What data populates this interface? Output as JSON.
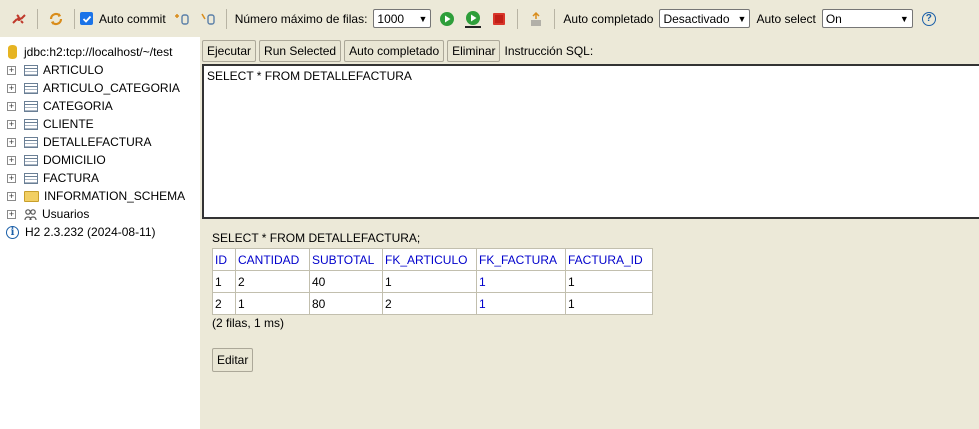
{
  "toolbar": {
    "auto_commit_label": "Auto commit",
    "max_rows_label": "Número máximo de filas:",
    "max_rows_value": "1000",
    "autocomplete_label": "Auto completado",
    "autocomplete_value": "Desactivado",
    "autoselect_label": "Auto select",
    "autoselect_value": "On",
    "help_glyph": "?"
  },
  "tree": {
    "connection": "jdbc:h2:tcp://localhost/~/test",
    "tables": [
      "ARTICULO",
      "ARTICULO_CATEGORIA",
      "CATEGORIA",
      "CLIENTE",
      "DETALLEFACTURA",
      "DOMICILIO",
      "FACTURA"
    ],
    "schema": "INFORMATION_SCHEMA",
    "users": "Usuarios",
    "version": "H2 2.3.232 (2024-08-11)"
  },
  "main": {
    "buttons": {
      "run": "Ejecutar",
      "run_selected": "Run Selected",
      "autocomplete": "Auto completado",
      "clear": "Eliminar"
    },
    "sql_label": "Instrucción SQL:",
    "sql_text": "SELECT * FROM DETALLEFACTURA",
    "result_query": "SELECT * FROM DETALLEFACTURA;",
    "columns": [
      "ID",
      "CANTIDAD",
      "SUBTOTAL",
      "FK_ARTICULO",
      "FK_FACTURA",
      "FACTURA_ID"
    ],
    "rows": [
      [
        "1",
        "2",
        "40",
        "1",
        "1",
        "1"
      ],
      [
        "2",
        "1",
        "80",
        "2",
        "1",
        "1"
      ]
    ],
    "rowcount": "(2 filas, 1 ms)",
    "edit_label": "Editar"
  }
}
